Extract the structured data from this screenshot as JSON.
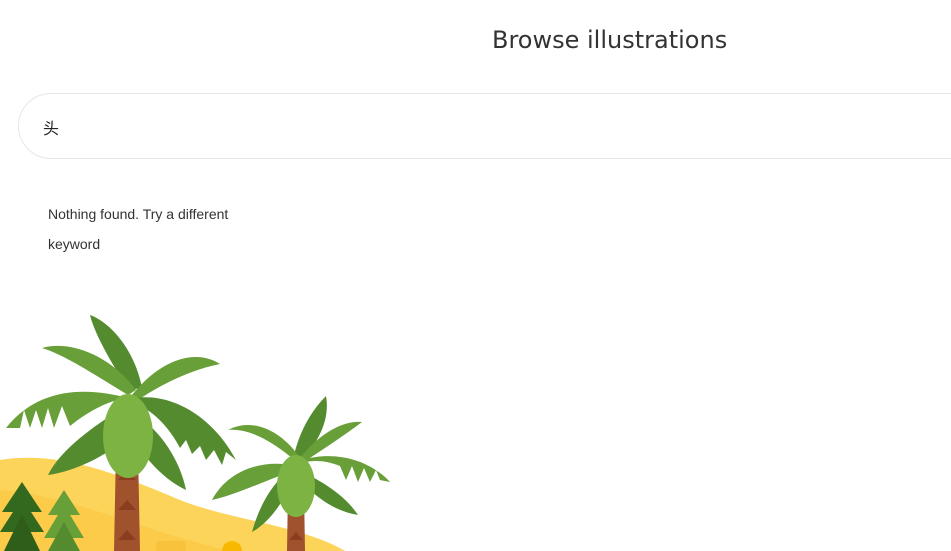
{
  "header": {
    "title": "Browse illustrations"
  },
  "search": {
    "value": "头",
    "placeholder": ""
  },
  "results": {
    "empty_message": "Nothing found. Try a different keyword"
  },
  "illustration": {
    "name": "palm-trees-beach-illustration",
    "colors": {
      "sand": "#fdd45a",
      "sand_dark": "#f9c23c",
      "leaf_light": "#7cb342",
      "leaf_mid": "#689f38",
      "leaf_dark": "#558b2f",
      "trunk": "#a0522d",
      "trunk_dark": "#8b3e1f",
      "pine": "#33691e"
    }
  }
}
